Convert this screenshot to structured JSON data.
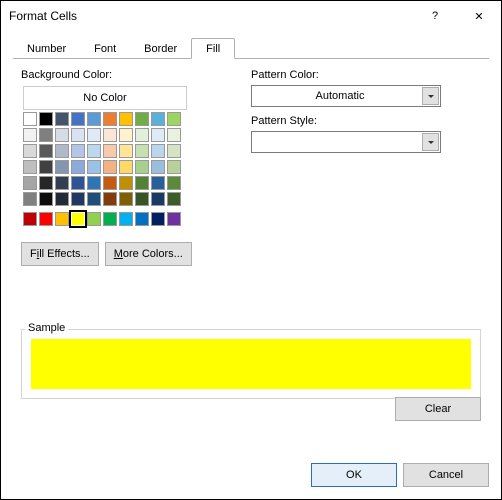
{
  "window": {
    "title": "Format Cells",
    "help": "?",
    "close": "✕"
  },
  "tabs": {
    "number": "Number",
    "font": "Font",
    "border": "Border",
    "fill": "Fill"
  },
  "fill": {
    "bg_label": "Background Color:",
    "no_color": "No Color",
    "fill_effects_pre": "F",
    "fill_effects_ul": "i",
    "fill_effects_post": "ll Effects...",
    "more_colors_ul": "M",
    "more_colors_post": "ore Colors...",
    "pattern_color_label": "Pattern Color:",
    "pattern_color_value": "Automatic",
    "pattern_style_label": "Pattern Style:",
    "pattern_style_value": ""
  },
  "palette": {
    "main": [
      [
        "#ffffff",
        "#000000",
        "#44546a",
        "#4472c4",
        "#5b9bd5",
        "#ed7d31",
        "#ffc000",
        "#70ad47",
        "#5ab0d8",
        "#9ed561"
      ],
      [
        "#f2f2f2",
        "#7f7f7f",
        "#d6dce4",
        "#d9e2f3",
        "#deebf6",
        "#fbe5d5",
        "#fff2cc",
        "#e2efd9",
        "#ddebf7",
        "#eaf1df"
      ],
      [
        "#d9d9d9",
        "#595959",
        "#aeb9ca",
        "#b4c6e7",
        "#bdd7ee",
        "#f7caac",
        "#ffe598",
        "#c5e0b3",
        "#bbd5ed",
        "#d5e3c5"
      ],
      [
        "#bfbfbf",
        "#404040",
        "#8496b0",
        "#8eaadb",
        "#9bc2e6",
        "#f4b183",
        "#ffd965",
        "#a8d08d",
        "#9abedb",
        "#b6d298"
      ],
      [
        "#a6a6a6",
        "#262626",
        "#333f50",
        "#2f5496",
        "#2e75b5",
        "#c55a11",
        "#bf9000",
        "#538135",
        "#2a6099",
        "#5b8a39"
      ],
      [
        "#808080",
        "#0d0d0d",
        "#222a35",
        "#1f3864",
        "#1e4e79",
        "#833c0c",
        "#7f6000",
        "#375623",
        "#183b66",
        "#3d5c26"
      ]
    ],
    "standard": [
      "#c00000",
      "#ff0000",
      "#ffc000",
      "#ffff00",
      "#92d050",
      "#00b050",
      "#00b0f0",
      "#0070c0",
      "#002060",
      "#7030a0"
    ],
    "selected": "#ffff00"
  },
  "sample": {
    "label": "Sample",
    "color": "#ffff00"
  },
  "buttons": {
    "clear": "Clear",
    "ok": "OK",
    "cancel": "Cancel"
  }
}
